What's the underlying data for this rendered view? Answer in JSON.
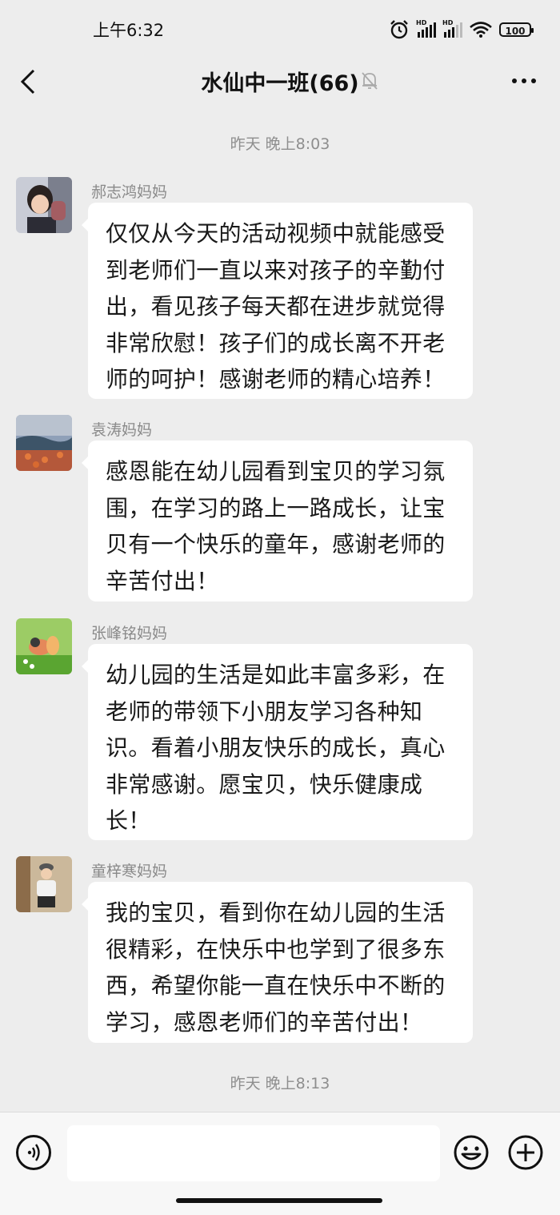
{
  "status_bar": {
    "time": "上午6:32",
    "hd_label": "HD",
    "battery": "100"
  },
  "header": {
    "title": "水仙中一班(66)",
    "back_icon": "chevron-left-icon",
    "mute_icon": "bell-muted-icon",
    "more_icon": "more-dots-icon"
  },
  "timestamps": [
    "昨天 晚上8:03",
    "昨天 晚上8:13"
  ],
  "messages": [
    {
      "sender": "郝志鸿妈妈",
      "text": "仅仅从今天的活动视频中就能感受到老师们一直以来对孩子的辛勤付出，看见孩子每天都在进步就觉得非常欣慰！孩子们的成长离不开老师的呵护！感谢老师的精心培养！"
    },
    {
      "sender": "袁涛妈妈",
      "text": "感恩能在幼儿园看到宝贝的学习氛围，在学习的路上一路成长，让宝贝有一个快乐的童年，感谢老师的辛苦付出！"
    },
    {
      "sender": "张峰铭妈妈",
      "text": "幼儿园的生活是如此丰富多彩，在老师的带领下小朋友学习各种知识。看着小朋友快乐的成长，真心非常感谢。愿宝贝，快乐健康成长！"
    },
    {
      "sender": "童梓寒妈妈",
      "text": "我的宝贝，看到你在幼儿园的生活很精彩，在快乐中也学到了很多东西，希望你能一直在快乐中不断的学习，感恩老师们的辛苦付出！"
    }
  ],
  "input_bar": {
    "voice_icon": "voice-input-icon",
    "emoji_icon": "emoji-icon",
    "plus_icon": "plus-circle-icon"
  }
}
